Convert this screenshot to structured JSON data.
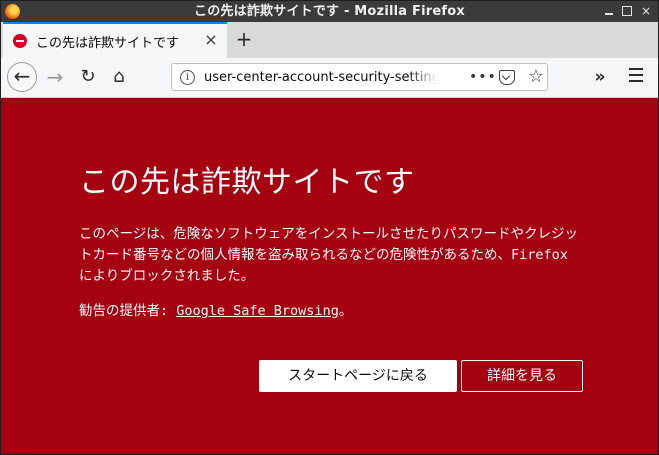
{
  "window": {
    "title": "この先は詐欺サイトです  -  Mozilla Firefox"
  },
  "tab": {
    "title": "この先は詐欺サイトです",
    "close_glyph": "×",
    "new_tab_glyph": "+"
  },
  "navbar": {
    "back_glyph": "←",
    "forward_glyph": "→",
    "reload_glyph": "↻",
    "home_glyph": "⌂",
    "url": "user-center-account-security-settings",
    "info_glyph": "i",
    "page_actions_glyph": "•••",
    "bookmark_glyph": "☆",
    "overflow_glyph": "»"
  },
  "content": {
    "heading": "この先は詐欺サイトです",
    "description": "このページは、危険なソフトウェアをインストールさせたりパスワードやクレジットカード番号などの個人情報を盗み取られるなどの危険性があるため、Firefox によりブロックされました。",
    "advisory_prefix": "勧告の提供者: ",
    "advisory_link": "Google Safe Browsing",
    "advisory_suffix": "。",
    "primary_button": "スタートページに戻る",
    "secondary_button": "詳細を見る"
  },
  "colors": {
    "content_background": "#a4000f",
    "titlebar": "#3b3b3b",
    "tab_accent": "#0a84ff"
  }
}
